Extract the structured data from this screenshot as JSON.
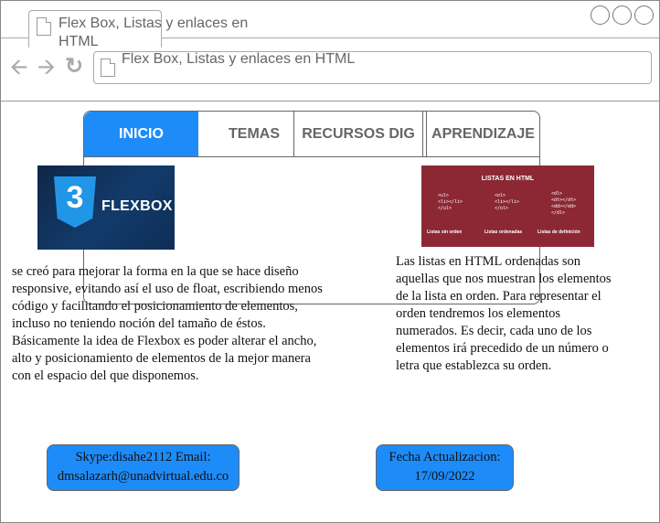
{
  "window": {
    "tab_title": "Flex Box, Listas y enlaces en HTML",
    "url": "Flex Box, Listas y enlaces en HTML"
  },
  "menu": {
    "items": [
      {
        "label": "INICIO"
      },
      {
        "label": "TEMAS"
      },
      {
        "label": "RECURSOS DIG"
      },
      {
        "label": "APRENDIZAJE"
      }
    ]
  },
  "flexbox_image": {
    "word": "FLEXBOX",
    "digit": "3"
  },
  "listas_image": {
    "title": "LISTAS EN HTML",
    "col1_code": "<ul>\n<li></li>\n</ul>",
    "col2_code": "<ol>\n<li></li>\n</ol>",
    "col3_code": "<dl>\n<dt></dt>\n<dd></dd>\n</dl>",
    "cap1": "Listas sin orden",
    "cap2": "Listas ordenadas",
    "cap3": "Listas de definición"
  },
  "content": {
    "flexbox_text": "se creó para mejorar la forma en la que se hace diseño responsive, evitando así el uso de float, escribiendo menos código y facilitando el posicionamiento de elementos, incluso no teniendo noción del tamaño de éstos. Básicamente la idea de Flexbox es poder alterar el ancho, alto y posicionamiento de elementos de la mejor manera con el espacio del que disponemos.",
    "listas_text": "Las listas en HTML ordenadas son aquellas que nos muestran los elementos de la lista en orden. Para representar el orden tendremos los elementos numerados. Es decir, cada uno de los elementos irá precedido de un número o letra que establezca su orden."
  },
  "footer": {
    "contact_line1": "Skype:disahe2112 Email:",
    "contact_line2": "dmsalazarh@unadvirtual.edu.co",
    "update_line1": "Fecha Actualizacion:",
    "update_line2": "17/09/2022"
  },
  "colors": {
    "accent": "#1e8cf8",
    "listas_bg": "#8c2834",
    "flexbox_bg": "#123b6b"
  }
}
